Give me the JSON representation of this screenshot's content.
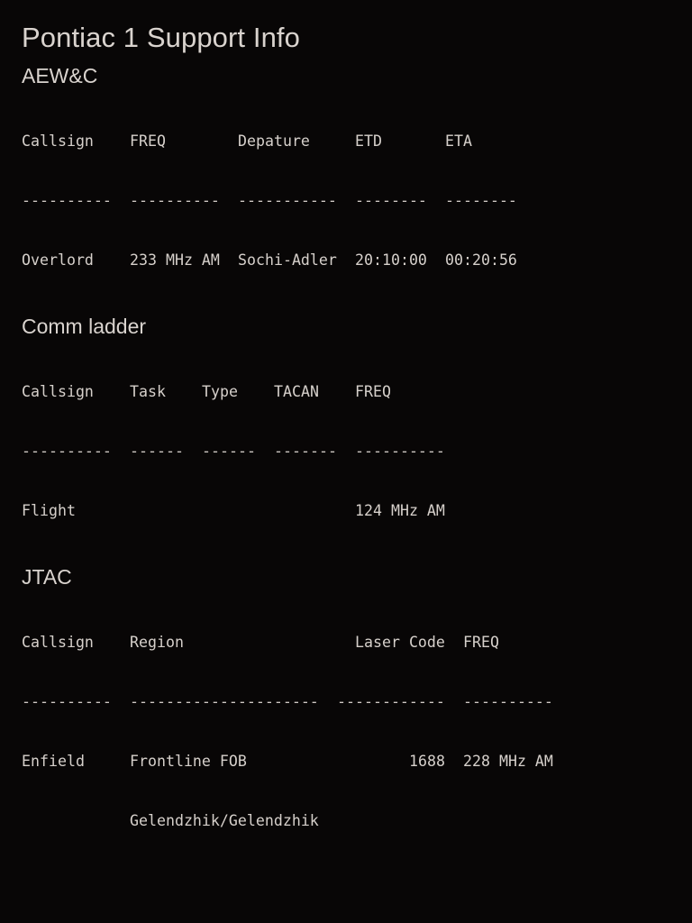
{
  "title": "Pontiac 1 Support Info",
  "aewc": {
    "heading": "AEW&C",
    "headers": [
      "Callsign",
      "FREQ",
      "Depature",
      "ETD",
      "ETA"
    ],
    "separators": [
      "----------",
      "----------",
      "-----------",
      "--------",
      "--------"
    ],
    "rows": [
      [
        "Overlord",
        "233 MHz AM",
        "Sochi-Adler",
        "20:10:00",
        "00:20:56"
      ]
    ]
  },
  "comm": {
    "heading": "Comm ladder",
    "headers": [
      "Callsign",
      "Task",
      "Type",
      "TACAN",
      "FREQ"
    ],
    "separators": [
      "----------",
      "------",
      "------",
      "-------",
      "----------"
    ],
    "rows": [
      [
        "Flight",
        "",
        "",
        "",
        "124 MHz AM"
      ]
    ]
  },
  "jtac": {
    "heading": "JTAC",
    "headers": [
      "Callsign",
      "Region",
      "Laser Code",
      "FREQ"
    ],
    "separators": [
      "----------",
      "---------------------",
      "------------",
      "----------"
    ],
    "rows": [
      [
        "Enfield",
        "Frontline FOB",
        "1688",
        "228 MHz AM"
      ],
      [
        "",
        "Gelendzhik/Gelendzhik",
        "",
        ""
      ]
    ]
  }
}
